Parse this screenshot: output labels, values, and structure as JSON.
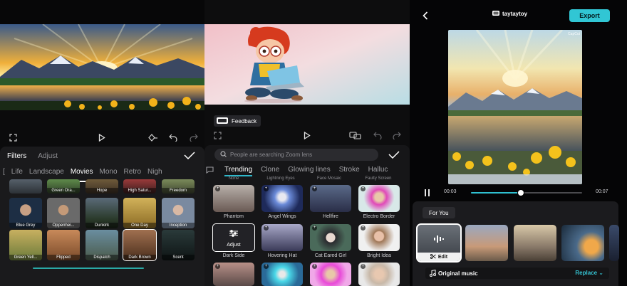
{
  "colors": {
    "accent": "#31c6d4",
    "sheet": "#1a1a1c",
    "background": "#0b0b0c"
  },
  "filters_panel": {
    "tabs": [
      {
        "label": "Filters",
        "active": true
      },
      {
        "label": "Adjust",
        "active": false
      }
    ],
    "categories": [
      {
        "label": "Life",
        "active": false
      },
      {
        "label": "Landscape",
        "active": false
      },
      {
        "label": "Movies",
        "active": true
      },
      {
        "label": "Mono",
        "active": false
      },
      {
        "label": "Retro",
        "active": false
      },
      {
        "label": "Nigh",
        "active": false
      }
    ],
    "filter_rows": [
      [
        "Green Ora...",
        "Hope",
        "High Satur...",
        "Freedom"
      ],
      [
        "Blue Grey",
        "Oppenhei...",
        "Dunkirk",
        "One Day",
        "Inception"
      ],
      [
        "Green Yell...",
        "Flipped",
        "Dispatch",
        "Dark Brown",
        "Scent"
      ]
    ],
    "selected_filter": "Dark Brown",
    "icons": [
      "fullscreen-icon",
      "play-icon",
      "keyframe-icon",
      "undo-icon",
      "redo-icon",
      "checkmark-icon"
    ]
  },
  "effects_panel": {
    "feedback_label": "Feedback",
    "search_placeholder": "People are searching Zoom lens",
    "categories": [
      {
        "label": "Trending",
        "active": true
      },
      {
        "label": "Clone",
        "active": false
      },
      {
        "label": "Glowing lines",
        "active": false
      },
      {
        "label": "Stroke",
        "active": false
      },
      {
        "label": "Halluc",
        "active": false
      }
    ],
    "top_partial_labels": [
      "None",
      "Lightning Eyes",
      "Face Mosaic",
      "Faulty Screen"
    ],
    "effect_rows": [
      [
        "Phantom",
        "Angel Wings",
        "Hellfire",
        "Electro Border"
      ],
      [
        "Dark Side",
        "Hovering Hat",
        "Cat Eared Girl",
        "Bright Idea"
      ]
    ],
    "adjust_label": "Adjust",
    "icons": [
      "fullscreen-icon",
      "play-icon",
      "compare-icon",
      "undo-icon",
      "redo-icon",
      "checkmark-icon",
      "comment-icon"
    ]
  },
  "editor_panel": {
    "project_name": "taytaytoy",
    "export_label": "Export",
    "watermark": "CapCut",
    "time_current": "00:03",
    "time_total": "00:07",
    "progress": 0.45,
    "section_label": "For You",
    "edit_label": "Edit",
    "music_title": "Original music",
    "replace_label": "Replace"
  }
}
